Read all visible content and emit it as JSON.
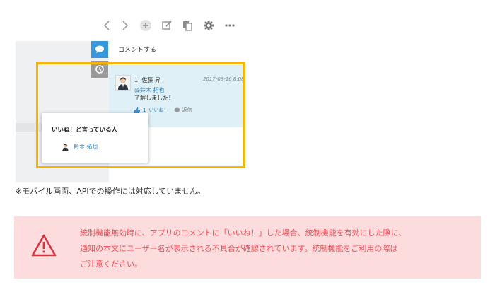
{
  "toolbar": {
    "icons": [
      "chevron-left-icon",
      "chevron-right-icon",
      "plus-icon",
      "edit-icon",
      "copy-icon",
      "gear-icon",
      "more-icon"
    ]
  },
  "comments": {
    "label": "コメントする",
    "entry": {
      "author": "1: 佐藤 昇",
      "timestamp": "2017-03-16 8:08",
      "mention": "@鈴木 拓也",
      "body": "了解しました！",
      "like_count": "1",
      "like_label": "いいね！",
      "reply_label": "返信"
    }
  },
  "likes_popover": {
    "title": "いいね！と言っている人",
    "user": "鈴木 拓也"
  },
  "note": "※モバイル画面、APIでの操作には対応していません。",
  "warning": {
    "lines": [
      "統制機能無効時に、アプリのコメントに「いいね！」した場合、統制機能を有効にした際に、",
      "通知の本文にユーザー名が表示される不具合が確認されています。統制機能をご利用の際は",
      "ご注意ください。"
    ]
  },
  "colors": {
    "accent_blue": "#3498db",
    "highlight_yellow": "#f7b500",
    "comment_bg": "#dff0f7",
    "warning_bg": "#fcdcdc",
    "warning_text": "#ef4a55"
  }
}
